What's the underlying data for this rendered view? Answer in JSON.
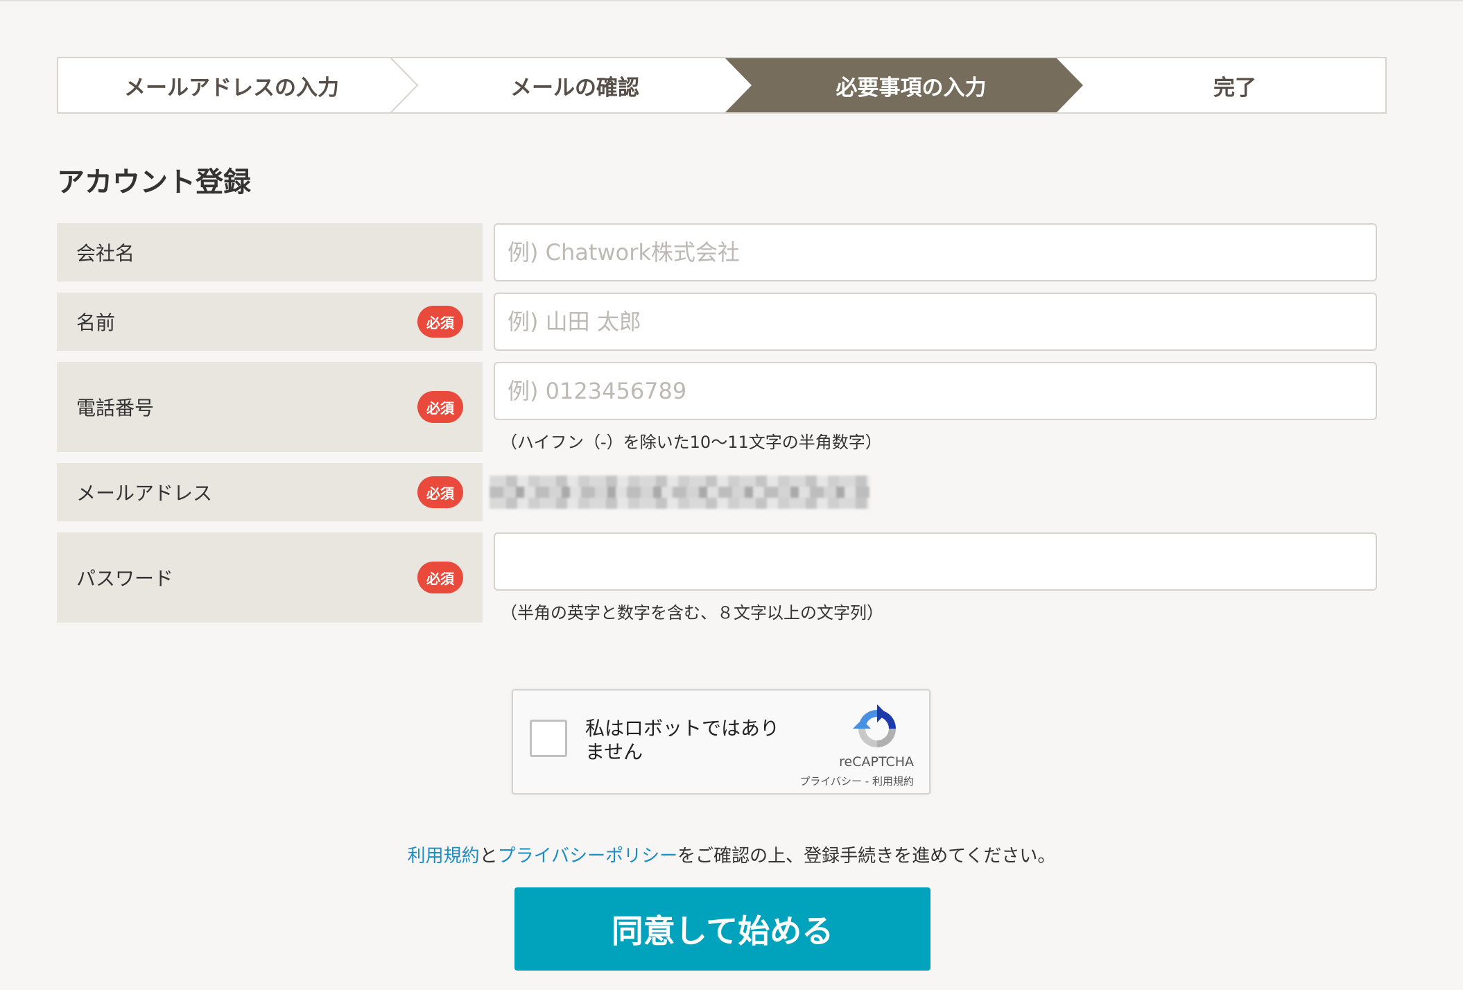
{
  "stepper": {
    "steps": [
      {
        "label": "メールアドレスの入力",
        "state": "done"
      },
      {
        "label": "メールの確認",
        "state": "done"
      },
      {
        "label": "必要事項の入力",
        "state": "active"
      },
      {
        "label": "完了",
        "state": "pending"
      }
    ],
    "active_color": "#776d5c"
  },
  "form": {
    "title": "アカウント登録",
    "required_badge": "必須",
    "company": {
      "label": "会社名",
      "placeholder": "例) Chatwork株式会社",
      "value": ""
    },
    "name": {
      "label": "名前",
      "placeholder": "例) 山田 太郎",
      "value": ""
    },
    "phone": {
      "label": "電話番号",
      "placeholder": "例) 0123456789",
      "value": "",
      "hint": "（ハイフン（-）を除いた10〜11文字の半角数字）"
    },
    "email": {
      "label": "メールアドレス"
    },
    "password": {
      "label": "パスワード",
      "value": "",
      "hint": "（半角の英字と数字を含む、８文字以上の文字列）"
    }
  },
  "captcha": {
    "text": "私はロボットではありません",
    "brand": "reCAPTCHA",
    "privacy": "プライバシー",
    "separator": " - ",
    "terms": "利用規約"
  },
  "notice": {
    "terms_link": "利用規約",
    "and": "と",
    "privacy_link": "プライバシーポリシー",
    "rest": "をご確認の上、登録手続きを進めてください。"
  },
  "submit": {
    "label": "同意して始める",
    "color": "#00a3bb"
  }
}
